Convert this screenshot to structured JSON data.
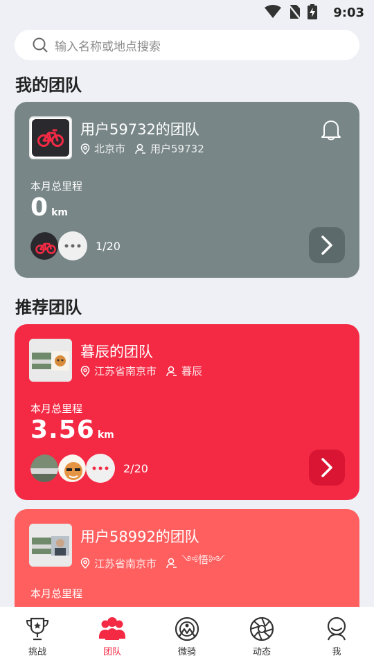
{
  "status_bar": {
    "time": "9:03"
  },
  "search": {
    "placeholder": "输入名称或地点搜索"
  },
  "sections": {
    "my_team": "我的团队",
    "recommended": "推荐团队"
  },
  "my_team_card": {
    "name": "用户59732的团队",
    "location": "北京市",
    "owner": "用户59732",
    "month_label": "本月总里程",
    "distance": "0",
    "unit": "km",
    "member_count": "1/20",
    "bg_color": "#788687"
  },
  "recommended_cards": [
    {
      "name": "暮辰的团队",
      "location": "江苏省南京市",
      "owner": "暮辰",
      "month_label": "本月总里程",
      "distance": "3.56",
      "unit": "km",
      "member_count": "2/20",
      "bg_color": "#f42a45"
    },
    {
      "name": "用户58992的团队",
      "location": "江苏省南京市",
      "owner": "༺悟༻",
      "month_label": "本月总里程",
      "bg_color": "#ff5f5f"
    }
  ],
  "tabbar": {
    "items": [
      {
        "label": "挑战",
        "icon": "trophy-icon"
      },
      {
        "label": "团队",
        "icon": "team-icon",
        "active": true
      },
      {
        "label": "微骑",
        "icon": "ride-icon"
      },
      {
        "label": "动态",
        "icon": "aperture-icon"
      },
      {
        "label": "我",
        "icon": "profile-icon"
      }
    ],
    "active_color": "#f42a45"
  }
}
